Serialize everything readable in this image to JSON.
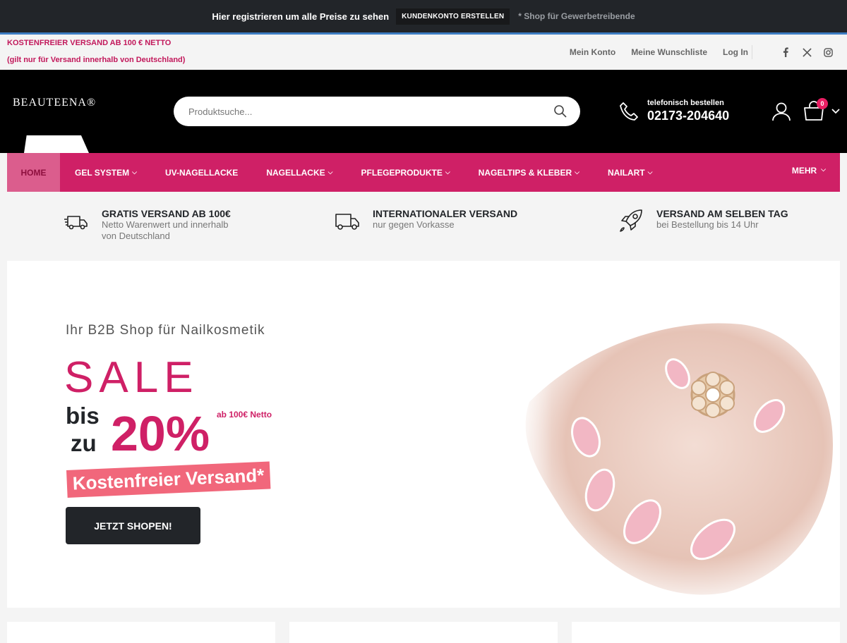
{
  "promo": {
    "text": "Hier registrieren um alle Preise zu sehen",
    "button": "KUNDENKONTO ERSTELLEN",
    "note": "* Shop für Gewerbetreibende"
  },
  "top_header": {
    "shipping_line1": "KOSTENFREIER VERSAND AB 100 € NETTO",
    "shipping_line2": "(gilt nur für Versand innerhalb von Deutschland)",
    "links": [
      "Mein Konto",
      "Meine Wunschliste",
      "Log In"
    ],
    "socials": [
      "facebook-icon",
      "x-icon",
      "instagram-icon"
    ]
  },
  "header": {
    "logo": "BEAUTEENA®",
    "search_placeholder": "Produktsuche...",
    "phone_label": "telefonisch bestellen",
    "phone_number": "02173-204640",
    "cart_count": "0"
  },
  "nav": {
    "items": [
      {
        "label": "HOME",
        "dropdown": false
      },
      {
        "label": "GEL SYSTEM",
        "dropdown": true
      },
      {
        "label": "UV-NAGELLACKE",
        "dropdown": false
      },
      {
        "label": "NAGELLACKE",
        "dropdown": true
      },
      {
        "label": "PFLEGEPRODUKTE",
        "dropdown": true
      },
      {
        "label": "NAGELTIPS & KLEBER",
        "dropdown": true
      },
      {
        "label": "NAILART",
        "dropdown": true
      }
    ],
    "more": "MEHR"
  },
  "features": [
    {
      "icon": "shipping-truck-icon",
      "title": "GRATIS VERSAND AB 100€",
      "subtitle": "Netto Warenwert und innerhalb von Deutschland"
    },
    {
      "icon": "truck-icon",
      "title": "INTERNATIONALER VERSAND",
      "subtitle": "nur gegen Vorkasse"
    },
    {
      "icon": "rocket-icon",
      "title": "VERSAND AM SELBEN TAG",
      "subtitle": "bei Bestellung bis 14 Uhr"
    }
  ],
  "hero": {
    "tagline": "Ihr B2B Shop für Nailkosmetik",
    "sale": "SALE",
    "bis": "bis",
    "zu": "zu",
    "percent": "20%",
    "netto_note": "ab 100€ Netto",
    "free_shipping": "Kostenfreier Versand*",
    "cta": "JETZT SHOPEN!"
  },
  "colors": {
    "brand_pink": "#cf2066",
    "dark": "#222529",
    "coral": "#f1677b"
  }
}
